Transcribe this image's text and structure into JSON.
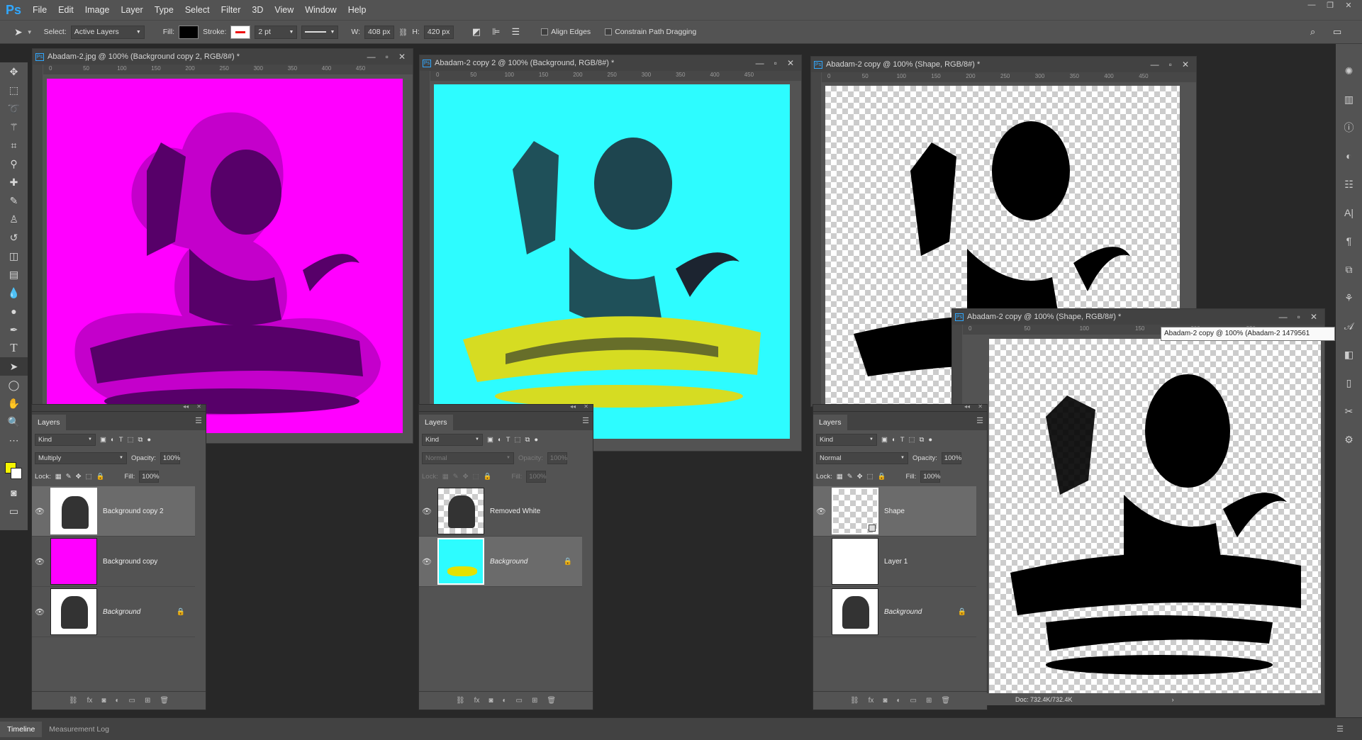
{
  "app": {
    "logo": "Ps"
  },
  "menu": [
    "File",
    "Edit",
    "Image",
    "Layer",
    "Type",
    "Select",
    "Filter",
    "3D",
    "View",
    "Window",
    "Help"
  ],
  "options": {
    "select_label": "Select:",
    "select_value": "Active Layers",
    "fill_label": "Fill:",
    "stroke_label": "Stroke:",
    "stroke_width": "2 pt",
    "w_label": "W:",
    "w_value": "408 px",
    "h_label": "H:",
    "h_value": "420 px",
    "align_edges": "Align Edges",
    "constrain": "Constrain Path Dragging"
  },
  "ruler_ticks": [
    "0",
    "50",
    "100",
    "150",
    "200",
    "250",
    "300",
    "350",
    "400",
    "450"
  ],
  "ruler_ticks_short": [
    "0",
    "50",
    "100",
    "150",
    "200",
    "250"
  ],
  "docs": [
    {
      "title": "Abadam-2.jpg @ 100% (Background copy 2, RGB/8#) *",
      "bg": "#ff00ff",
      "ink": "#3c0a50"
    },
    {
      "title": "Abadam-2 copy 2 @ 100% (Background, RGB/8#) *",
      "bg": "#2dfcff",
      "ink": "#1c2430",
      "crown": "#d6dc22"
    },
    {
      "title": "Abadam-2 copy @ 100% (Shape, RGB/8#) *"
    },
    {
      "title": "Abadam-2 copy @ 100% (Shape, RGB/8#) *"
    }
  ],
  "panels": [
    {
      "tab": "Layers",
      "kind": "Kind",
      "blend": "Multiply",
      "opacity_label": "Opacity:",
      "opacity": "100%",
      "lock_label": "Lock:",
      "fill_label": "Fill:",
      "fill": "100%",
      "layers": [
        {
          "name": "Background copy 2",
          "visible": true,
          "selected": true,
          "italic": false,
          "locked": false,
          "thumb": "lion"
        },
        {
          "name": "Background copy",
          "visible": true,
          "selected": false,
          "italic": false,
          "locked": false,
          "thumb": "magenta"
        },
        {
          "name": "Background",
          "visible": true,
          "selected": false,
          "italic": true,
          "locked": true,
          "thumb": "lion"
        }
      ]
    },
    {
      "tab": "Layers",
      "kind": "Kind",
      "blend": "Normal",
      "opacity_label": "Opacity:",
      "opacity": "100%",
      "lock_label": "Lock:",
      "fill_label": "Fill:",
      "fill": "100%",
      "layers": [
        {
          "name": "Removed White",
          "visible": true,
          "selected": false,
          "italic": false,
          "locked": false,
          "thumb": "lion"
        },
        {
          "name": "Background",
          "visible": true,
          "selected": true,
          "italic": true,
          "locked": true,
          "thumb": "cyan"
        }
      ]
    },
    {
      "tab": "Layers",
      "kind": "Kind",
      "blend": "Normal",
      "opacity_label": "Opacity:",
      "opacity": "100%",
      "lock_label": "Lock:",
      "fill_label": "Fill:",
      "fill": "100%",
      "layers": [
        {
          "name": "Shape",
          "visible": true,
          "selected": true,
          "italic": false,
          "locked": false,
          "thumb": "checker"
        },
        {
          "name": "Layer 1",
          "visible": false,
          "selected": false,
          "italic": false,
          "locked": false,
          "thumb": "white"
        },
        {
          "name": "Background",
          "visible": false,
          "selected": false,
          "italic": true,
          "locked": true,
          "thumb": "lion"
        }
      ]
    }
  ],
  "tooltip": "Abadam-2 copy @ 100% (Abadam-2 1479561",
  "status": "Doc: 732.4K/732.4K",
  "timeline_tabs": [
    "Timeline",
    "Measurement Log"
  ]
}
